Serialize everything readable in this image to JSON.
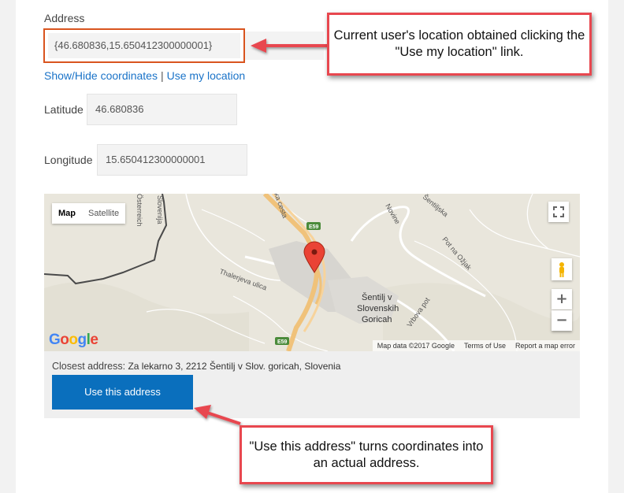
{
  "form": {
    "address_label": "Address",
    "address_value": "{46.680836,15.650412300000001}",
    "toggle_link": "Show/Hide coordinates",
    "separator": "|",
    "location_link": "Use my location",
    "latitude_label": "Latitude",
    "latitude_value": "46.680836",
    "longitude_label": "Longitude",
    "longitude_value": "15.650412300000001"
  },
  "map": {
    "type_map": "Map",
    "type_satellite": "Satellite",
    "fullscreen_icon": "fullscreen-icon",
    "pegman_icon": "pegman-icon",
    "zoom_in": "+",
    "zoom_out": "−",
    "logo": "Google",
    "footer": {
      "data": "Map data ©2017 Google",
      "terms": "Terms of Use",
      "report": "Report a map error"
    },
    "labels": {
      "street1": "Thalerjeva ulica",
      "street2": "Novine",
      "street3": "Šentiljska",
      "street4": "Pot na Ožjak",
      "street5": "Vrbova pot",
      "street6": "ka cesta",
      "region1": "Österreich",
      "region2": "Slovenija",
      "road1": "E59",
      "road2": "E59",
      "town_l1": "Šentilj v",
      "town_l2": "Slovenskih",
      "town_l3": "Goricah"
    }
  },
  "closest": {
    "label": "Closest address:",
    "value": "Za lekarno 3, 2212 Šentilj v Slov. goricah, Slovenia"
  },
  "use_button": "Use this address",
  "callouts": {
    "top": "Current user's location obtained clicking the \"Use my location\" link.",
    "bottom": "\"Use this address\" turns coordinates into an actual address."
  },
  "colors": {
    "highlight_border": "#d9541e",
    "callout_border": "#e8474f",
    "button_bg": "#0a6fbd",
    "link": "#1a73c8"
  }
}
